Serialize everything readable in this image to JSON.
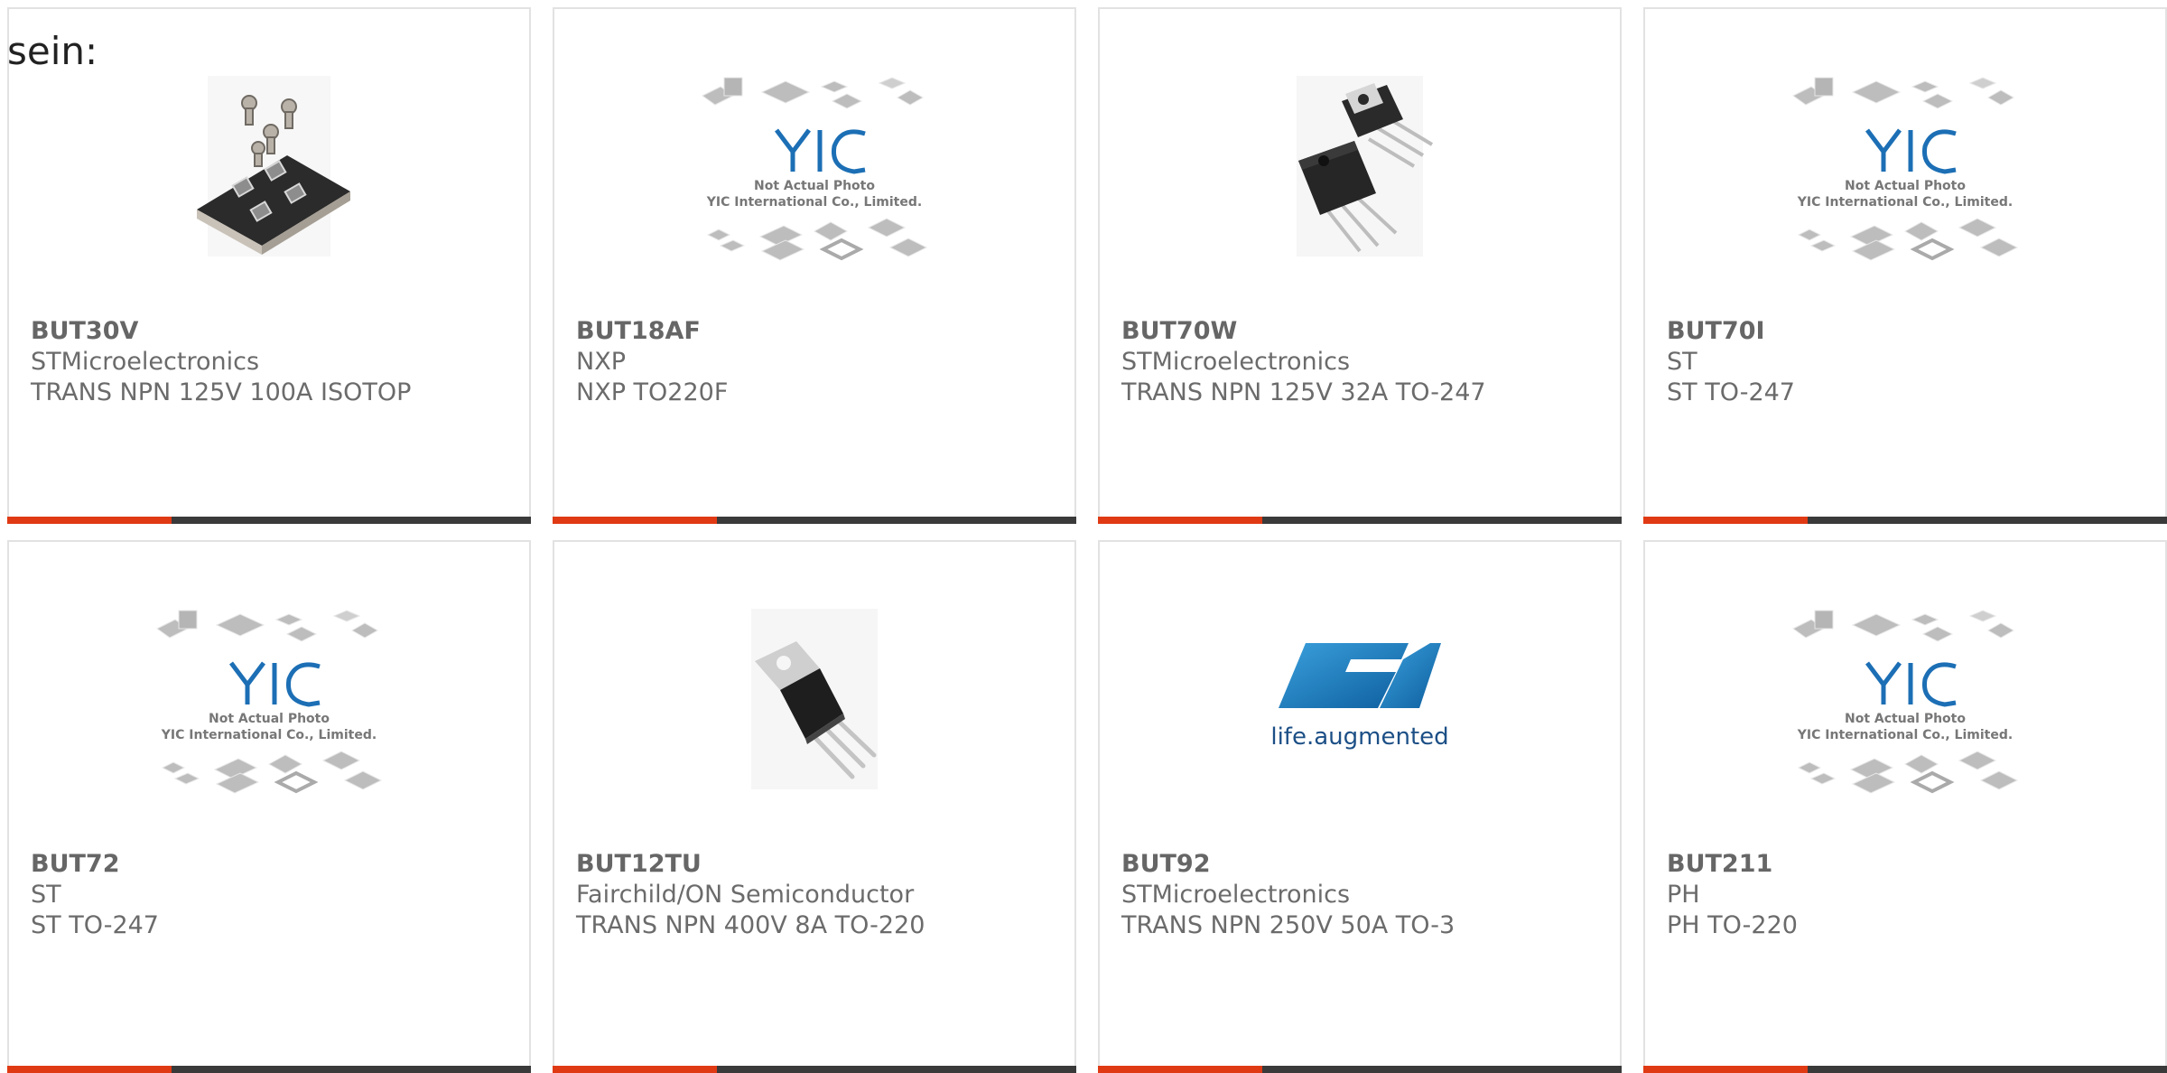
{
  "leading_text": "sein:",
  "placeholder_image": {
    "line1": "Not Actual Photo",
    "line2": "YIC International Co., Limited.",
    "logo_text": "YIC"
  },
  "st_logo": {
    "tagline": "life.augmented"
  },
  "products": [
    {
      "part": "BUT30V",
      "manufacturer": "STMicroelectronics",
      "description": "TRANS NPN 125V 100A ISOTOP",
      "image": "isotop-module"
    },
    {
      "part": "BUT18AF",
      "manufacturer": "NXP",
      "description": "NXP TO220F",
      "image": "placeholder"
    },
    {
      "part": "BUT70W",
      "manufacturer": "STMicroelectronics",
      "description": "TRANS NPN 125V 32A TO-247",
      "image": "to247-transistors"
    },
    {
      "part": "BUT70I",
      "manufacturer": "ST",
      "description": "ST TO-247",
      "image": "placeholder"
    },
    {
      "part": "BUT72",
      "manufacturer": "ST",
      "description": "ST TO-247",
      "image": "placeholder"
    },
    {
      "part": "BUT12TU",
      "manufacturer": "Fairchild/ON Semiconductor",
      "description": "TRANS NPN 400V 8A TO-220",
      "image": "to220-transistor"
    },
    {
      "part": "BUT92",
      "manufacturer": "STMicroelectronics",
      "description": "TRANS NPN 250V 50A TO-3",
      "image": "st-logo"
    },
    {
      "part": "BUT211",
      "manufacturer": "PH",
      "description": "PH TO-220",
      "image": "placeholder"
    }
  ],
  "colors": {
    "accent": "#e03a14",
    "bar": "#3a3a3a",
    "border": "#e2e2e2",
    "st_blue": "#1c6fb5"
  }
}
